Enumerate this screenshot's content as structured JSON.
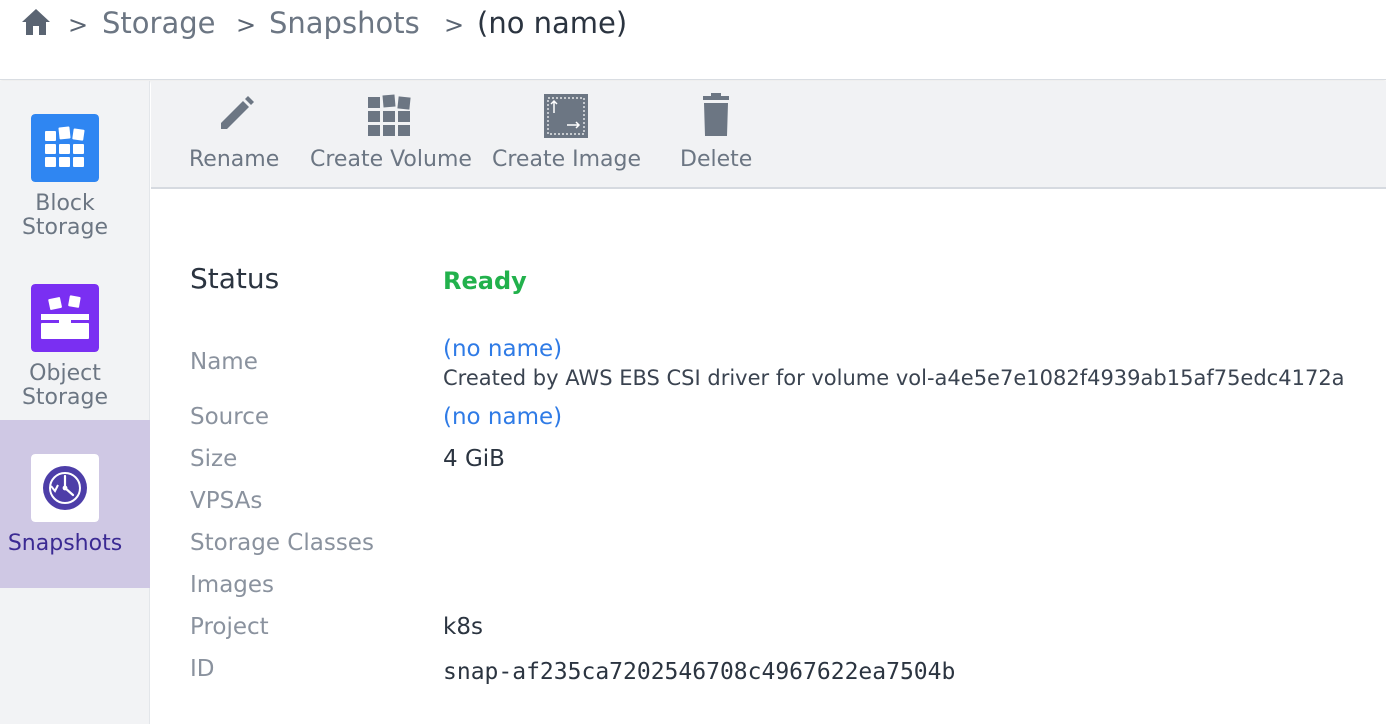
{
  "breadcrumb": {
    "home_icon": "home-icon",
    "items": [
      "Storage",
      "Snapshots",
      "(no name)"
    ],
    "separator": ">"
  },
  "sidebar": {
    "items": [
      {
        "label_line1": "Block",
        "label_line2": "Storage",
        "icon": "block-storage-icon",
        "color": "#2f86f2",
        "active": false
      },
      {
        "label_line1": "Object",
        "label_line2": "Storage",
        "icon": "object-storage-icon",
        "color": "#7a2ff2",
        "active": false
      },
      {
        "label_line1": "Snapshots",
        "label_line2": "",
        "icon": "snapshots-icon",
        "color": "#4d3ea8",
        "active": true
      }
    ]
  },
  "toolbar": {
    "rename_label": "Rename",
    "create_volume_label": "Create Volume",
    "create_image_label": "Create Image",
    "delete_label": "Delete"
  },
  "details": {
    "status_label": "Status",
    "status_value": "Ready",
    "name_label": "Name",
    "name_value": "(no name)",
    "name_description": "Created by AWS EBS CSI driver for volume vol-a4e5e7e1082f4939ab15af75edc4172a",
    "source_label": "Source",
    "source_value": "(no name)",
    "size_label": "Size",
    "size_value": "4 GiB",
    "vpsas_label": "VPSAs",
    "storage_classes_label": "Storage Classes",
    "images_label": "Images",
    "project_label": "Project",
    "project_value": "k8s",
    "id_label": "ID",
    "id_value": "snap-af235ca7202546708c4967622ea7504b"
  },
  "colors": {
    "status_ready": "#22b14c",
    "link": "#2f7be6",
    "active_sidebar": "#cfc8e4"
  }
}
